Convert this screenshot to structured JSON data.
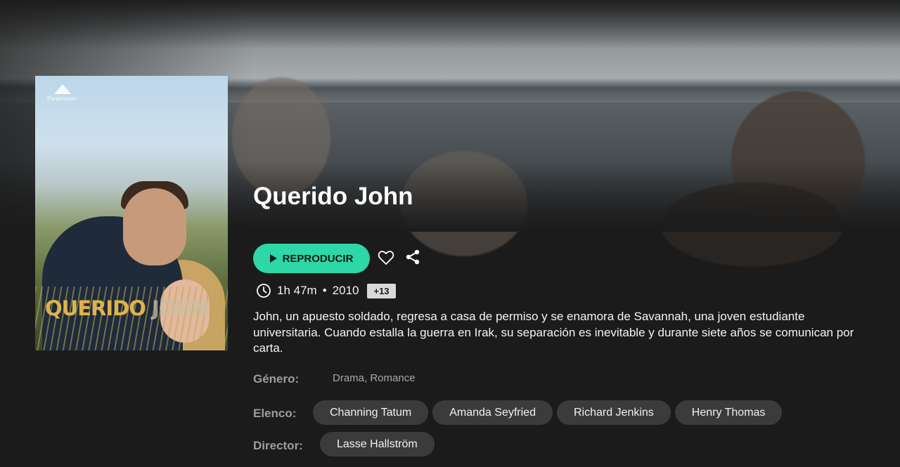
{
  "movie": {
    "title": "Querido John",
    "poster": {
      "studio": "Paramount+",
      "title_part1": "QUERIDO ",
      "title_part2": "JOHN"
    },
    "actions": {
      "play_label": "REPRODUCIR",
      "play_icon": "play-icon",
      "favorite_icon": "heart-icon",
      "share_icon": "share-icon"
    },
    "meta": {
      "duration_icon": "clock-icon",
      "duration": "1h 47m",
      "separator": "•",
      "year": "2010",
      "rating": "+13"
    },
    "description": "John, un apuesto soldado, regresa a casa de permiso y se enamora de Savannah, una joven estudiante universitaria. Cuando estalla la guerra en Irak, su separación es inevitable y durante siete años se comunican por carta.",
    "details": {
      "genre_label": "Género:",
      "genre_value": "Drama, Romance",
      "cast_label": "Elenco:",
      "cast": [
        "Channing Tatum",
        "Amanda Seyfried",
        "Richard Jenkins",
        "Henry Thomas"
      ],
      "director_label": "Director:",
      "directors": [
        "Lasse Hallström"
      ]
    }
  },
  "colors": {
    "accent": "#2ed7a7",
    "background": "#1b1b1b",
    "chip": "#3b3b3b",
    "label": "#9d9d9d"
  }
}
